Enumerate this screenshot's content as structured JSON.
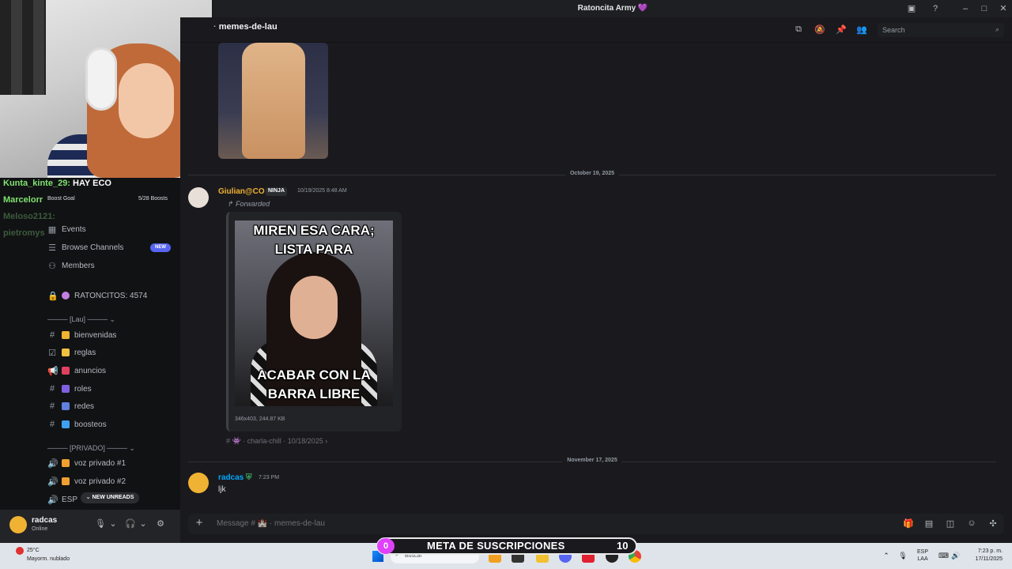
{
  "window": {
    "title": "Ratoncita Army 💜"
  },
  "stream_overlay": {
    "chat": [
      {
        "user": "Kunta_kinte_29:",
        "message": "HAY ECO",
        "color": "#7fe36f"
      },
      {
        "user": "Marcelorr",
        "message": "",
        "color": "#7fe36f"
      },
      {
        "user": "Meloso2121:",
        "message": "",
        "color": "#3c5b3c"
      },
      {
        "user": "pietromys",
        "message": "",
        "color": "#3c5b3c"
      }
    ],
    "subs_goal": {
      "current": "0",
      "label": "META DE SUSCRIPCIONES",
      "goal": "10"
    }
  },
  "sidebar": {
    "boost": {
      "label": "Boost Goal",
      "count": "5/28 Boosts"
    },
    "items": [
      {
        "label": "Events",
        "icon": "calendar-icon"
      },
      {
        "label": "Browse Channels",
        "icon": "browse-icon",
        "badge": "NEW"
      },
      {
        "label": "Members",
        "icon": "members-icon"
      }
    ],
    "locked_channel": "RATONCITOS: 4574",
    "categories": [
      {
        "label": "──── [Lau] ────",
        "channels": [
          {
            "label": "bienvenidas",
            "icon": "hashtag-icon",
            "emoji_color": "#f0b232"
          },
          {
            "label": "reglas",
            "icon": "rules-channel-icon",
            "emoji_color": "#f0c040"
          },
          {
            "label": "anuncios",
            "icon": "announcement-icon",
            "emoji_color": "#e04060"
          },
          {
            "label": "roles",
            "icon": "hashtag-icon",
            "emoji_color": "#8060e0"
          },
          {
            "label": "redes",
            "icon": "hashtag-icon",
            "emoji_color": "#6080e0"
          },
          {
            "label": "boosteos",
            "icon": "hashtag-icon",
            "emoji_color": "#40a0f0"
          }
        ]
      },
      {
        "label": "──── [PRIVADO] ────",
        "channels": [
          {
            "label": "voz privado #1",
            "icon": "voice-icon",
            "emoji_color": "#f0a030"
          },
          {
            "label": "voz privado #2",
            "icon": "voice-icon",
            "emoji_color": "#f0a030"
          },
          {
            "label": "ESP",
            "icon": "voice-icon",
            "emoji_color": ""
          }
        ]
      }
    ],
    "new_unreads": "NEW UNREADS"
  },
  "user_panel": {
    "name": "radcas",
    "status": "Online"
  },
  "channel": {
    "name": "memes-de-lau",
    "search_placeholder": "Search"
  },
  "messages": {
    "date1": "October 19, 2025",
    "giulian": {
      "author": "Giulian@CO",
      "tag": "NINJA",
      "timestamp": "10/19/2025 8:48 AM",
      "forwarded": "Forwarded",
      "meme_top": "MIREN ESA CARA; LISTA PARA",
      "meme_bottom": "ACABAR CON LA BARRA LIBRE",
      "file_meta": "346x403, 244.87 KB",
      "origin": "# 👾 · charla-chill · 10/18/2025 ›"
    },
    "date2": "November 17, 2025",
    "radcas": {
      "author": "radcas",
      "timestamp": "7:23 PM",
      "text": "ljk"
    }
  },
  "composer": {
    "placeholder": "Message # 🏰 · memes-de-lau"
  },
  "taskbar": {
    "weather_temp": "25°C",
    "weather_desc": "Mayorm. nublado",
    "search_placeholder": "Buscar",
    "lang_top": "ESP",
    "lang_bottom": "LAA",
    "time": "7:23 p. m.",
    "date": "17/11/2025"
  }
}
